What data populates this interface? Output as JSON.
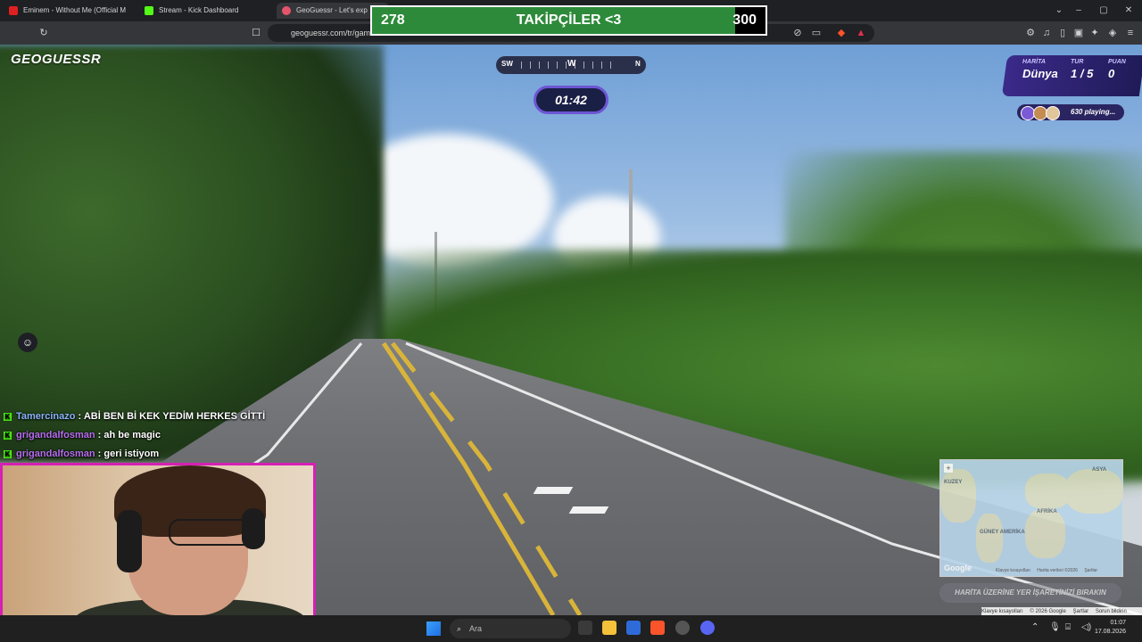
{
  "browser": {
    "tabs": [
      {
        "title": "Eminem - Without Me (Official M",
        "icon": "youtube-icon"
      },
      {
        "title": "Stream - Kick Dashboard",
        "icon": "kick-icon"
      },
      {
        "title": "GeoGuessr - Let's exp",
        "icon": "geoguessr-icon"
      }
    ],
    "url": "geoguessr.com/tr/gam"
  },
  "overlay": {
    "follower_current": "278",
    "follower_goal_label": "TAKİPÇİLER <3",
    "follower_target": "300",
    "follower_progress": 0.927
  },
  "game": {
    "logo": "GEOGUESSR",
    "compass": {
      "left": "SW",
      "center": "W",
      "right": "N"
    },
    "timer": "01:42",
    "score": {
      "map_label": "HARİTA",
      "map_value": "Dünya",
      "round_label": "TUR",
      "round_value": "1 / 5",
      "points_label": "PUAN",
      "points_value": "0"
    },
    "playing": "630 playing...",
    "guess_button": "HARİTA ÜZERİNE YER İŞARETİNİZİ BIRAKIN",
    "minimap_labels": {
      "asia": "ASYA",
      "africa": "AFRİKA",
      "south_america": "GÜNEY AMERİKA",
      "north": "KUZEY",
      "google": "Google"
    },
    "map_footer": [
      "Klavye kısayolları",
      "Harita verileri ©2026",
      "Şartlar"
    ],
    "footer_links": [
      "Klavye kısayolları",
      "© 2026 Google",
      "Şartlar",
      "Sorun bildirin"
    ]
  },
  "chat": [
    {
      "user": "Tamercinazo",
      "sep": " : ",
      "text": "ABİ BEN Bİ KEK YEDİM HERKES GİTTİ"
    },
    {
      "user": "grigandalfosman",
      "sep": " : ",
      "text": "ah be magic"
    },
    {
      "user": "grigandalfosman",
      "sep": " : ",
      "text": "geri istiyom"
    }
  ],
  "taskbar": {
    "search_placeholder": "Ara",
    "time": "01:07",
    "date": "17.08.2026"
  },
  "colors": {
    "accent": "#6d55d4",
    "webcam_border": "#d61fb5",
    "follow_bar": "#2d8a3a"
  }
}
